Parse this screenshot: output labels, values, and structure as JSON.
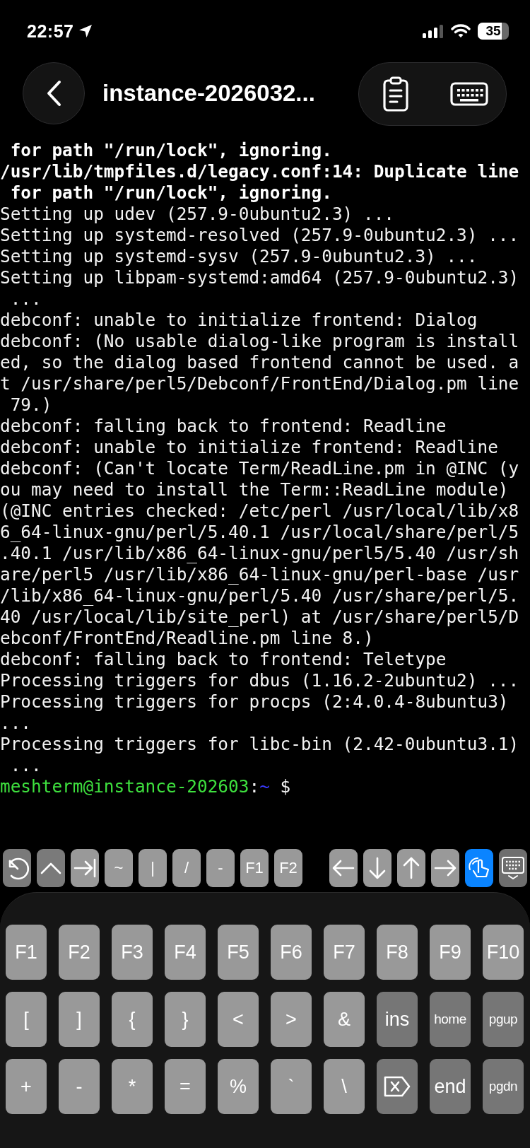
{
  "status_bar": {
    "time": "22:57",
    "battery": "35"
  },
  "nav": {
    "title": "instance-2026032..."
  },
  "terminal": {
    "lines": [
      {
        "text": " for path \"/run/lock\", ignoring.",
        "bold": true
      },
      {
        "text": "/usr/lib/tmpfiles.d/legacy.conf:14: Duplicate line",
        "bold": true
      },
      {
        "text": " for path \"/run/lock\", ignoring.",
        "bold": true
      },
      {
        "text": "Setting up udev (257.9-0ubuntu2.3) ...",
        "bold": false
      },
      {
        "text": "Setting up systemd-resolved (257.9-0ubuntu2.3) ...",
        "bold": false
      },
      {
        "text": "Setting up systemd-sysv (257.9-0ubuntu2.3) ...",
        "bold": false
      },
      {
        "text": "Setting up libpam-systemd:amd64 (257.9-0ubuntu2.3)",
        "bold": false
      },
      {
        "text": " ...",
        "bold": false
      },
      {
        "text": "debconf: unable to initialize frontend: Dialog",
        "bold": false
      },
      {
        "text": "debconf: (No usable dialog-like program is install",
        "bold": false
      },
      {
        "text": "ed, so the dialog based frontend cannot be used. a",
        "bold": false
      },
      {
        "text": "t /usr/share/perl5/Debconf/FrontEnd/Dialog.pm line",
        "bold": false
      },
      {
        "text": " 79.)",
        "bold": false
      },
      {
        "text": "debconf: falling back to frontend: Readline",
        "bold": false
      },
      {
        "text": "debconf: unable to initialize frontend: Readline",
        "bold": false
      },
      {
        "text": "debconf: (Can't locate Term/ReadLine.pm in @INC (y",
        "bold": false
      },
      {
        "text": "ou may need to install the Term::ReadLine module)",
        "bold": false
      },
      {
        "text": "(@INC entries checked: /etc/perl /usr/local/lib/x8",
        "bold": false
      },
      {
        "text": "6_64-linux-gnu/perl/5.40.1 /usr/local/share/perl/5",
        "bold": false
      },
      {
        "text": ".40.1 /usr/lib/x86_64-linux-gnu/perl5/5.40 /usr/sh",
        "bold": false
      },
      {
        "text": "are/perl5 /usr/lib/x86_64-linux-gnu/perl-base /usr",
        "bold": false
      },
      {
        "text": "/lib/x86_64-linux-gnu/perl/5.40 /usr/share/perl/5.",
        "bold": false
      },
      {
        "text": "40 /usr/local/lib/site_perl) at /usr/share/perl5/D",
        "bold": false
      },
      {
        "text": "ebconf/FrontEnd/Readline.pm line 8.)",
        "bold": false
      },
      {
        "text": "debconf: falling back to frontend: Teletype",
        "bold": false
      },
      {
        "text": "Processing triggers for dbus (1.16.2-2ubuntu2) ...",
        "bold": false
      },
      {
        "text": "Processing triggers for procps (2:4.0.4-8ubuntu3)",
        "bold": false
      },
      {
        "text": "...",
        "bold": false
      },
      {
        "text": "Processing triggers for libc-bin (2.42-0ubuntu3.1)",
        "bold": false
      },
      {
        "text": " ...",
        "bold": false
      }
    ],
    "prompt": {
      "user_host": "meshterm@instance-202603",
      "separator": ":",
      "path": "~",
      "symbol": "$"
    }
  },
  "accessory_bar": {
    "left_keys": [
      {
        "kind": "history",
        "color": "#7a7a7a"
      },
      {
        "kind": "caret",
        "color": "#7a7a7a"
      },
      {
        "kind": "tab",
        "color": "#999999"
      },
      {
        "kind": "text",
        "label": "~",
        "color": "#999999"
      },
      {
        "kind": "text",
        "label": "|",
        "color": "#999999"
      },
      {
        "kind": "text",
        "label": "/",
        "color": "#999999"
      },
      {
        "kind": "text",
        "label": "-",
        "color": "#999999"
      },
      {
        "kind": "text",
        "label": "F1",
        "color": "#999999"
      },
      {
        "kind": "text",
        "label": "F2",
        "color": "#999999"
      }
    ],
    "right_keys": [
      {
        "kind": "left",
        "color": "#999999"
      },
      {
        "kind": "down",
        "color": "#999999"
      },
      {
        "kind": "up",
        "color": "#999999"
      },
      {
        "kind": "right",
        "color": "#999999"
      },
      {
        "kind": "touch",
        "color": "#0a84ff"
      },
      {
        "kind": "hide-keyboard",
        "color": "#6e6e6e"
      }
    ]
  },
  "keyboard": {
    "rows": [
      [
        {
          "kind": "text",
          "label": "F1",
          "color": "#999999"
        },
        {
          "kind": "text",
          "label": "F2",
          "color": "#999999"
        },
        {
          "kind": "text",
          "label": "F3",
          "color": "#999999"
        },
        {
          "kind": "text",
          "label": "F4",
          "color": "#999999"
        },
        {
          "kind": "text",
          "label": "F5",
          "color": "#999999"
        },
        {
          "kind": "text",
          "label": "F6",
          "color": "#999999"
        },
        {
          "kind": "text",
          "label": "F7",
          "color": "#999999"
        },
        {
          "kind": "text",
          "label": "F8",
          "color": "#999999"
        },
        {
          "kind": "text",
          "label": "F9",
          "color": "#999999"
        },
        {
          "kind": "text",
          "label": "F10",
          "color": "#999999"
        }
      ],
      [
        {
          "kind": "text",
          "label": "[",
          "color": "#999999"
        },
        {
          "kind": "text",
          "label": "]",
          "color": "#999999"
        },
        {
          "kind": "text",
          "label": "{",
          "color": "#999999"
        },
        {
          "kind": "text",
          "label": "}",
          "color": "#999999"
        },
        {
          "kind": "text",
          "label": "<",
          "color": "#999999"
        },
        {
          "kind": "text",
          "label": ">",
          "color": "#999999"
        },
        {
          "kind": "text",
          "label": "&",
          "color": "#999999"
        },
        {
          "kind": "text",
          "label": "ins",
          "color": "#767676"
        },
        {
          "kind": "text",
          "label": "home",
          "color": "#767676"
        },
        {
          "kind": "text",
          "label": "pgup",
          "color": "#767676"
        }
      ],
      [
        {
          "kind": "text",
          "label": "+",
          "color": "#999999"
        },
        {
          "kind": "text",
          "label": "-",
          "color": "#999999"
        },
        {
          "kind": "text",
          "label": "*",
          "color": "#999999"
        },
        {
          "kind": "text",
          "label": "=",
          "color": "#999999"
        },
        {
          "kind": "text",
          "label": "%",
          "color": "#999999"
        },
        {
          "kind": "text",
          "label": "`",
          "color": "#999999"
        },
        {
          "kind": "text",
          "label": "\\",
          "color": "#999999"
        },
        {
          "kind": "delete",
          "color": "#767676"
        },
        {
          "kind": "text",
          "label": "end",
          "color": "#767676"
        },
        {
          "kind": "text",
          "label": "pgdn",
          "color": "#767676"
        }
      ]
    ]
  }
}
